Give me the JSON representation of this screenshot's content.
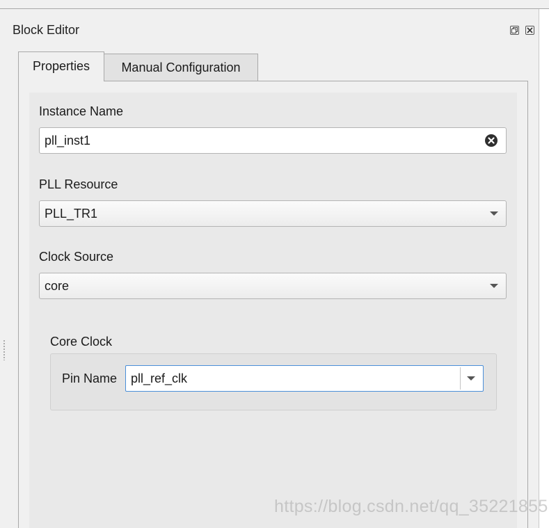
{
  "panel": {
    "title": "Block Editor",
    "float_icon": "float-window-icon",
    "close_icon": "close-icon"
  },
  "tabs": [
    {
      "label": "Properties",
      "active": true
    },
    {
      "label": "Manual Configuration",
      "active": false
    }
  ],
  "form": {
    "instance_name_label": "Instance Name",
    "instance_name_value": "pll_inst1",
    "clear_icon": "clear-circle-x-icon",
    "pll_resource_label": "PLL Resource",
    "pll_resource_value": "PLL_TR1",
    "clock_source_label": "Clock Source",
    "clock_source_value": "core"
  },
  "core_clock": {
    "group_label": "Core Clock",
    "pin_name_label": "Pin Name",
    "pin_name_value": "pll_ref_clk"
  },
  "watermark": "https://blog.csdn.net/qq_35221855",
  "colors": {
    "focus_border": "#4a8fd9",
    "panel_bg": "#f0f0f0",
    "content_bg": "#e9e9e9"
  }
}
